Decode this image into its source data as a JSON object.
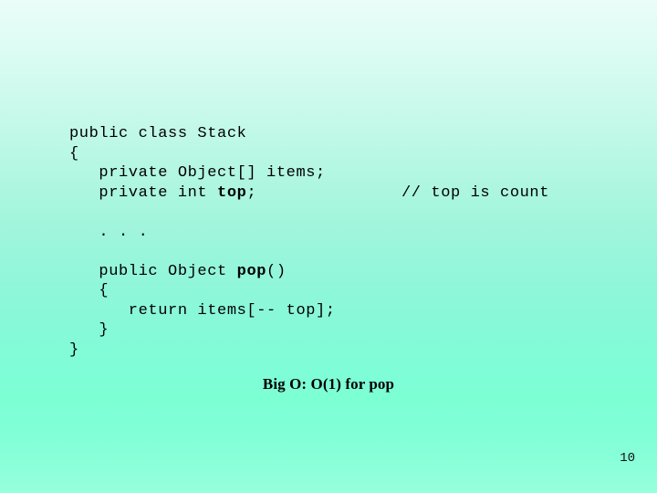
{
  "slide": {
    "background": {
      "top_color": "#eafdf8",
      "peak_color": "#7dffd4",
      "bottom_color": "#96ffdc"
    },
    "page_number": "10"
  },
  "code": {
    "language": "java",
    "lines": [
      {
        "id": "class-decl",
        "text": "public class Stack",
        "bold_token": "",
        "comment": ""
      },
      {
        "id": "class-open",
        "text": "{",
        "bold_token": "",
        "comment": ""
      },
      {
        "id": "field-items",
        "text": "   private Object[] items;",
        "bold_token": "",
        "comment": ""
      },
      {
        "id": "field-top",
        "text": "   private int ",
        "bold_token": "top",
        "text_after": ";",
        "comment": "// top is count"
      },
      {
        "id": "gap-1",
        "text": "",
        "bold_token": "",
        "comment": ""
      },
      {
        "id": "ellipsis",
        "text": "   . . .",
        "bold_token": "",
        "comment": ""
      },
      {
        "id": "gap-2",
        "text": "",
        "bold_token": "",
        "comment": ""
      },
      {
        "id": "method-sig",
        "text": "   public Object ",
        "bold_token": "pop",
        "text_after": "()",
        "comment": ""
      },
      {
        "id": "method-open",
        "text": "   {",
        "bold_token": "",
        "comment": ""
      },
      {
        "id": "method-return",
        "text": "      return items[-- top];",
        "bold_token": "",
        "comment": ""
      },
      {
        "id": "method-close",
        "text": "   }",
        "bold_token": "",
        "comment": ""
      },
      {
        "id": "class-close",
        "text": "}",
        "bold_token": "",
        "comment": ""
      }
    ]
  },
  "caption": {
    "text": "Big O: O(1) for pop"
  }
}
